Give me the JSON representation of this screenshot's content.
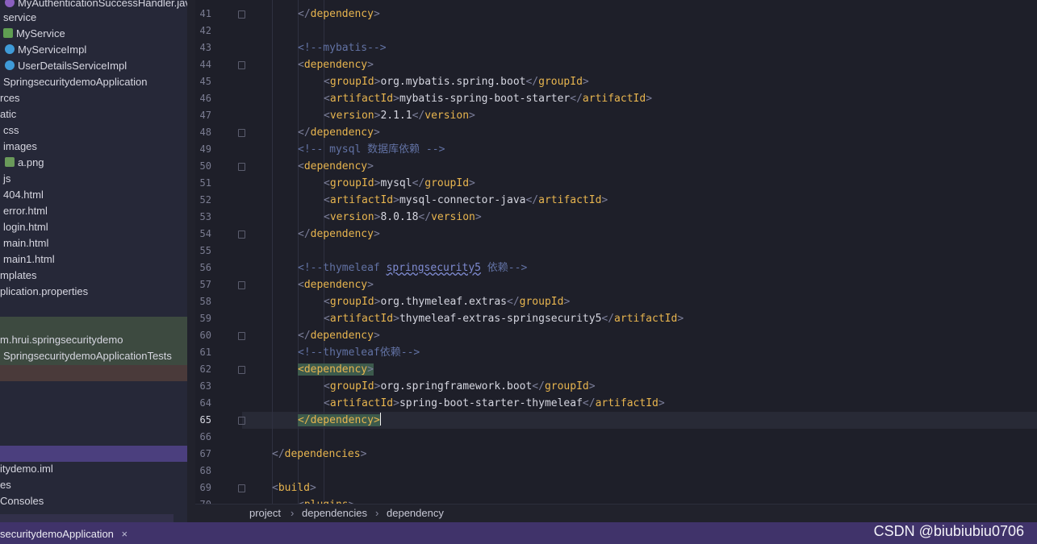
{
  "sidebar": {
    "items": [
      {
        "label": "MyAuthenticationSuccessHandler.java",
        "icon": "java-class-icon"
      },
      {
        "label": "service",
        "icon": "package-icon"
      },
      {
        "label": "MyService",
        "icon": "interface-icon"
      },
      {
        "label": "MyServiceImpl",
        "icon": "class-icon"
      },
      {
        "label": "UserDetailsServiceImpl",
        "icon": "class-icon"
      },
      {
        "label": "SpringsecuritydemoApplication",
        "icon": "spring-app-icon"
      },
      {
        "label": "rces",
        "icon": ""
      },
      {
        "label": "atic",
        "icon": ""
      },
      {
        "label": "css",
        "icon": ""
      },
      {
        "label": "images",
        "icon": ""
      },
      {
        "label": "a.png",
        "icon": "image-file-icon"
      },
      {
        "label": "js",
        "icon": ""
      },
      {
        "label": "404.html",
        "icon": ""
      },
      {
        "label": "error.html",
        "icon": ""
      },
      {
        "label": "login.html",
        "icon": ""
      },
      {
        "label": "main.html",
        "icon": ""
      },
      {
        "label": "main1.html",
        "icon": ""
      },
      {
        "label": "mplates",
        "icon": ""
      },
      {
        "label": "plication.properties",
        "icon": ""
      },
      {
        "label": "m.hrui.springsecuritydemo",
        "icon": ""
      },
      {
        "label": "SpringsecuritydemoApplicationTests",
        "icon": ""
      },
      {
        "label": "itydemo.iml",
        "icon": ""
      },
      {
        "label": "es",
        "icon": ""
      },
      {
        "label": "Consoles",
        "icon": ""
      }
    ]
  },
  "editor": {
    "line_numbers": [
      "41",
      "42",
      "43",
      "44",
      "45",
      "46",
      "47",
      "48",
      "49",
      "50",
      "51",
      "52",
      "53",
      "54",
      "55",
      "56",
      "57",
      "58",
      "59",
      "60",
      "61",
      "62",
      "63",
      "64",
      "65",
      "66",
      "67",
      "68",
      "69",
      "70"
    ],
    "current_line": "65",
    "lines": {
      "l41_close": "dependency",
      "l43_comment": "<!--mybatis-->",
      "l44_open": "dependency",
      "l45": {
        "tag": "groupId",
        "value": "org.mybatis.spring.boot"
      },
      "l46": {
        "tag": "artifactId",
        "value": "mybatis-spring-boot-starter"
      },
      "l47": {
        "tag": "version",
        "value": "2.1.1"
      },
      "l48_close": "dependency",
      "l49_comment": "<!-- mysql 数据库依赖 -->",
      "l50_open": "dependency",
      "l51": {
        "tag": "groupId",
        "value": "mysql"
      },
      "l52": {
        "tag": "artifactId",
        "value": "mysql-connector-java"
      },
      "l53": {
        "tag": "version",
        "value": "8.0.18"
      },
      "l54_close": "dependency",
      "l56_comment_a": "<!--thymeleaf ",
      "l56_comment_b": "springsecurity5",
      "l56_comment_c": " 依赖-->",
      "l57_open": "dependency",
      "l58": {
        "tag": "groupId",
        "value": "org.thymeleaf.extras"
      },
      "l59": {
        "tag": "artifactId",
        "value": "thymeleaf-extras-springsecurity5"
      },
      "l60_close": "dependency",
      "l61_comment": "<!--thymeleaf依赖-->",
      "l62_open": "dependency",
      "l63": {
        "tag": "groupId",
        "value": "org.springframework.boot"
      },
      "l64": {
        "tag": "artifactId",
        "value": "spring-boot-starter-thymeleaf"
      },
      "l65_close": "dependency",
      "l67_close": "dependencies",
      "l69_open": "build",
      "l70_open": "plugins"
    }
  },
  "breadcrumb": [
    "project",
    "dependencies",
    "dependency"
  ],
  "run_tab": {
    "label": "securitydemoApplication",
    "close": "×"
  },
  "watermark": "CSDN @biubiubiu0706",
  "colors": {
    "tag": "#e8b54f",
    "comment": "#6272a4",
    "text": "#d5d6e0",
    "selection_bar": "#40336a"
  }
}
